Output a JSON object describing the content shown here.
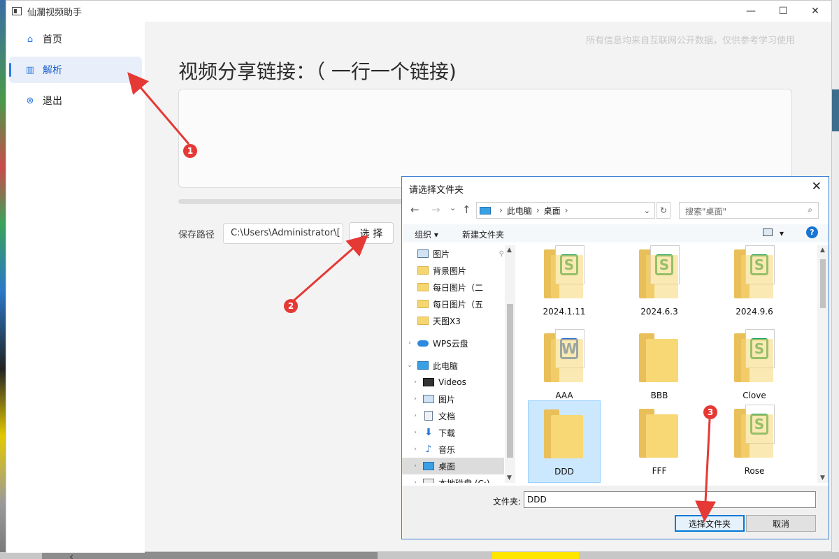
{
  "app": {
    "title": "仙瀾视频助手",
    "window_controls": {
      "minimize": "—",
      "maximize": "☐",
      "close": "✕"
    }
  },
  "sidebar": {
    "items": [
      {
        "label": "首页",
        "icon": "bank-icon",
        "glyph": "⌂"
      },
      {
        "label": "解析",
        "icon": "board-icon",
        "glyph": "▥"
      },
      {
        "label": "退出",
        "icon": "close-circle-icon",
        "glyph": "⊗"
      }
    ],
    "collapse": "‹"
  },
  "main": {
    "disclaimer": "所有信息均来自互联网公开数据，仅供参考学习使用",
    "heading": "视频分享链接：（ 一行一个链接)",
    "link_input_value": "",
    "save_label": "保存路径",
    "save_path": "C:\\Users\\Administrator\\[",
    "choose_label": "选 择"
  },
  "dialog": {
    "title": "请选择文件夹",
    "close": "✕",
    "nav": {
      "back": "←",
      "forward": "→",
      "recent": "⌄",
      "up": "↑"
    },
    "address": {
      "root": "此电脑",
      "current": "桌面"
    },
    "refresh": "↻",
    "search_placeholder": "搜索\"桌面\"",
    "toolbar": {
      "organize": "组织 ▾",
      "new_folder": "新建文件夹",
      "view_dropdown": "▾",
      "help": "?"
    },
    "tree": [
      {
        "label": "图片",
        "icon": "pictures-icon",
        "kind": "pic",
        "expander": ""
      },
      {
        "label": "背景图片",
        "icon": "folder-icon",
        "kind": "folder",
        "expander": ""
      },
      {
        "label": "每日图片（二",
        "icon": "folder-icon",
        "kind": "folder",
        "expander": ""
      },
      {
        "label": "每日图片（五",
        "icon": "folder-icon",
        "kind": "folder",
        "expander": ""
      },
      {
        "label": "天图X3",
        "icon": "folder-icon",
        "kind": "folder",
        "expander": ""
      },
      {
        "label": "WPS云盘",
        "icon": "cloud-icon",
        "kind": "cloud",
        "expander": "›"
      },
      {
        "label": "此电脑",
        "icon": "computer-icon",
        "kind": "pc",
        "expander": "⌄"
      },
      {
        "label": "Videos",
        "icon": "video-icon",
        "kind": "video",
        "expander": "›"
      },
      {
        "label": "图片",
        "icon": "pictures-icon",
        "kind": "pic",
        "expander": "›"
      },
      {
        "label": "文档",
        "icon": "document-icon",
        "kind": "doc",
        "expander": "›"
      },
      {
        "label": "下载",
        "icon": "download-icon",
        "kind": "down",
        "expander": "›"
      },
      {
        "label": "音乐",
        "icon": "music-icon",
        "kind": "music",
        "expander": "›"
      },
      {
        "label": "桌面",
        "icon": "desktop-icon",
        "kind": "pc",
        "expander": "›",
        "selected": true
      },
      {
        "label": "本地磁盘 (C:)",
        "icon": "drive-icon",
        "kind": "drive",
        "expander": "›"
      }
    ],
    "files": [
      {
        "name": "2024.1.11",
        "badge": "S"
      },
      {
        "name": "2024.6.3",
        "badge": "S"
      },
      {
        "name": "2024.9.6",
        "badge": "S"
      },
      {
        "name": "AAA",
        "badge": "W"
      },
      {
        "name": "BBB",
        "badge": ""
      },
      {
        "name": "Clove",
        "badge": "S"
      },
      {
        "name": "DDD",
        "badge": "",
        "selected": true
      },
      {
        "name": "FFF",
        "badge": ""
      },
      {
        "name": "Rose",
        "badge": "S"
      }
    ],
    "folder_label": "文件夹:",
    "folder_value": "DDD",
    "select_button": "选择文件夹",
    "cancel_button": "取消"
  },
  "annotations": {
    "markers": [
      "1",
      "2",
      "3"
    ],
    "color": "#e53935"
  }
}
